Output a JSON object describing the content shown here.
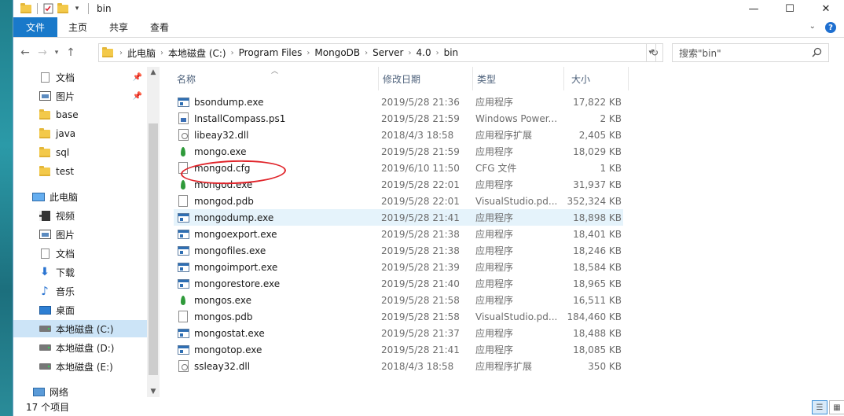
{
  "window": {
    "title": "bin",
    "controls": {
      "minimize": "—",
      "maximize": "☐",
      "close": "✕"
    }
  },
  "ribbon": {
    "tabs": [
      "文件",
      "主页",
      "共享",
      "查看"
    ]
  },
  "address": {
    "crumbs": [
      "此电脑",
      "本地磁盘 (C:)",
      "Program Files",
      "MongoDB",
      "Server",
      "4.0",
      "bin"
    ],
    "search_placeholder": "搜索\"bin\""
  },
  "nav": {
    "items": [
      {
        "label": "文档",
        "icon": "doc-icon",
        "pinned": true
      },
      {
        "label": "图片",
        "icon": "picture-icon",
        "pinned": true
      },
      {
        "label": "base",
        "icon": "folder-icon"
      },
      {
        "label": "java",
        "icon": "folder-icon"
      },
      {
        "label": "sql",
        "icon": "folder-icon"
      },
      {
        "label": "test",
        "icon": "folder-icon"
      },
      {
        "label": "此电脑",
        "icon": "computer-icon"
      },
      {
        "label": "视频",
        "icon": "video-icon"
      },
      {
        "label": "图片",
        "icon": "picture-icon"
      },
      {
        "label": "文档",
        "icon": "doc-icon"
      },
      {
        "label": "下载",
        "icon": "download-icon"
      },
      {
        "label": "音乐",
        "icon": "music-icon"
      },
      {
        "label": "桌面",
        "icon": "desktop-icon"
      },
      {
        "label": "本地磁盘 (C:)",
        "icon": "drive-icon",
        "selected": true
      },
      {
        "label": "本地磁盘 (D:)",
        "icon": "drive-icon"
      },
      {
        "label": "本地磁盘 (E:)",
        "icon": "drive-icon"
      },
      {
        "label": "网络",
        "icon": "network-icon"
      }
    ]
  },
  "columns": {
    "name": "名称",
    "date": "修改日期",
    "type": "类型",
    "size": "大小"
  },
  "files": [
    {
      "name": "bsondump.exe",
      "date": "2019/5/28 21:36",
      "type": "应用程序",
      "size": "17,822 KB",
      "icon": "exe-icon"
    },
    {
      "name": "InstallCompass.ps1",
      "date": "2019/5/28 21:59",
      "type": "Windows Power...",
      "size": "2 KB",
      "icon": "ps-icon"
    },
    {
      "name": "libeay32.dll",
      "date": "2018/4/3 18:58",
      "type": "应用程序扩展",
      "size": "2,405 KB",
      "icon": "dll-icon"
    },
    {
      "name": "mongo.exe",
      "date": "2019/5/28 21:59",
      "type": "应用程序",
      "size": "18,029 KB",
      "icon": "mongo-leaf-icon"
    },
    {
      "name": "mongod.cfg",
      "date": "2019/6/10 11:50",
      "type": "CFG 文件",
      "size": "1 KB",
      "icon": "doc-icon"
    },
    {
      "name": "mongod.exe",
      "date": "2019/5/28 22:01",
      "type": "应用程序",
      "size": "31,937 KB",
      "icon": "mongo-leaf-icon"
    },
    {
      "name": "mongod.pdb",
      "date": "2019/5/28 22:01",
      "type": "VisualStudio.pd...",
      "size": "352,324 KB",
      "icon": "doc-icon"
    },
    {
      "name": "mongodump.exe",
      "date": "2019/5/28 21:41",
      "type": "应用程序",
      "size": "18,898 KB",
      "icon": "exe-icon",
      "highlight": true
    },
    {
      "name": "mongoexport.exe",
      "date": "2019/5/28 21:38",
      "type": "应用程序",
      "size": "18,401 KB",
      "icon": "exe-icon"
    },
    {
      "name": "mongofiles.exe",
      "date": "2019/5/28 21:38",
      "type": "应用程序",
      "size": "18,246 KB",
      "icon": "exe-icon"
    },
    {
      "name": "mongoimport.exe",
      "date": "2019/5/28 21:39",
      "type": "应用程序",
      "size": "18,584 KB",
      "icon": "exe-icon"
    },
    {
      "name": "mongorestore.exe",
      "date": "2019/5/28 21:40",
      "type": "应用程序",
      "size": "18,965 KB",
      "icon": "exe-icon"
    },
    {
      "name": "mongos.exe",
      "date": "2019/5/28 21:58",
      "type": "应用程序",
      "size": "16,511 KB",
      "icon": "mongo-leaf-icon"
    },
    {
      "name": "mongos.pdb",
      "date": "2019/5/28 21:58",
      "type": "VisualStudio.pd...",
      "size": "184,460 KB",
      "icon": "doc-icon"
    },
    {
      "name": "mongostat.exe",
      "date": "2019/5/28 21:37",
      "type": "应用程序",
      "size": "18,488 KB",
      "icon": "exe-icon"
    },
    {
      "name": "mongotop.exe",
      "date": "2019/5/28 21:41",
      "type": "应用程序",
      "size": "18,085 KB",
      "icon": "exe-icon"
    },
    {
      "name": "ssleay32.dll",
      "date": "2018/4/3 18:58",
      "type": "应用程序扩展",
      "size": "350 KB",
      "icon": "dll-icon"
    }
  ],
  "status": {
    "count": "17 个项目"
  },
  "colors": {
    "accent": "#1979ca",
    "selection": "#cce4f7",
    "annotation": "#e0242a"
  }
}
